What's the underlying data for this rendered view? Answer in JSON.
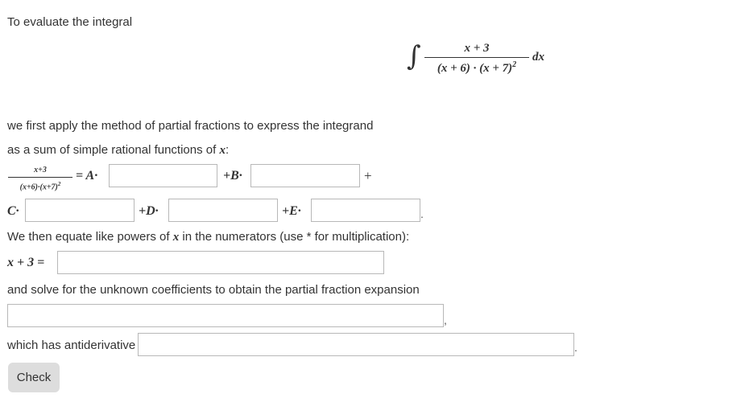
{
  "intro": "To evaluate the integral",
  "integral": {
    "sign": "∫",
    "numerator": "x + 3",
    "denominator": "(x + 6) · (x + 7)",
    "exponent": "2",
    "differential": "dx"
  },
  "method_line1": "we first apply the method of partial fractions to express the integrand",
  "method_line2_text": "as a sum of simple rational functions of ",
  "method_line2_var": "x",
  "method_line2_colon": ":",
  "decomposition": {
    "small_numerator": "x+3",
    "small_denominator": "(x+6)·(x+7)",
    "small_exponent": "2",
    "equals_A": "= A·",
    "plus_B": "+B·",
    "plus_trailing": "+",
    "C": "C·",
    "plus_D": "+D·",
    "plus_E": "+E·",
    "period": "."
  },
  "equate_text_1": "We then equate like powers of ",
  "equate_var": "x",
  "equate_text_2": " in the numerators (use * for multiplication):",
  "numerator_label": "x + 3 =",
  "solve_text": "and solve for the unknown coefficients to obtain the partial fraction expansion",
  "expansion_comma": ",",
  "antiderivative_label": "which has antiderivative",
  "antiderivative_period": ".",
  "check_label": "Check",
  "inputs": {
    "A": "",
    "B": "",
    "C": "",
    "D": "",
    "E": "",
    "numerator": "",
    "expansion": "",
    "antiderivative": ""
  }
}
